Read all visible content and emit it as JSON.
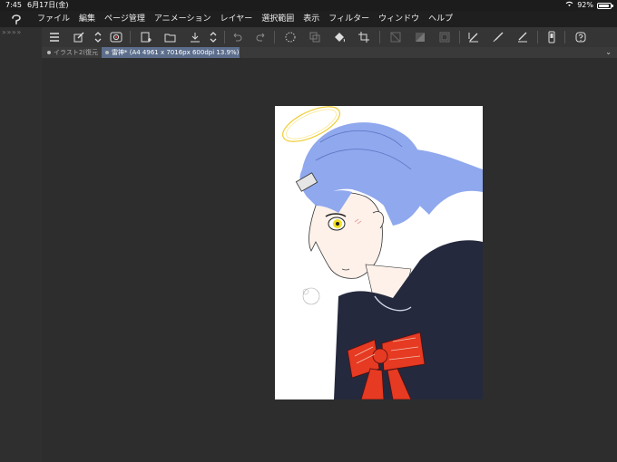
{
  "status": {
    "time": "7:45",
    "date": "6月17日(金)",
    "battery_percent_label": "92%",
    "battery_level": 0.92
  },
  "menu": {
    "items": [
      "ファイル",
      "編集",
      "ページ管理",
      "アニメーション",
      "レイヤー",
      "選択範囲",
      "表示",
      "フィルター",
      "ウィンドウ",
      "ヘルプ"
    ]
  },
  "toolbar": {
    "collapse_glyphs": "» » » »",
    "icons": [
      "menu-icon",
      "edit-icon",
      "updown-icon",
      "eye-icon",
      "new-page-icon",
      "open-folder-icon",
      "save-icon",
      "updown2-icon",
      "undo-icon",
      "redo-icon",
      "spinner-icon",
      "transform-icon",
      "fill-icon",
      "crop-icon",
      "slash-box-icon",
      "gradient-icon",
      "box-icon",
      "pen-check-icon",
      "brush-icon",
      "pencil-icon",
      "device-icon",
      "help-icon"
    ]
  },
  "tabs": [
    {
      "label": "イラスト2(復元",
      "active": false
    },
    {
      "label": "雷神* (A4 4961 x 7016px 600dpi 13.9%)",
      "active": true
    }
  ],
  "colors": {
    "accent_tab": "#5c6e8c",
    "hair": "#8fa8ee",
    "bow": "#e63a22",
    "uniform": "#25293d",
    "eye": "#f0e020"
  }
}
